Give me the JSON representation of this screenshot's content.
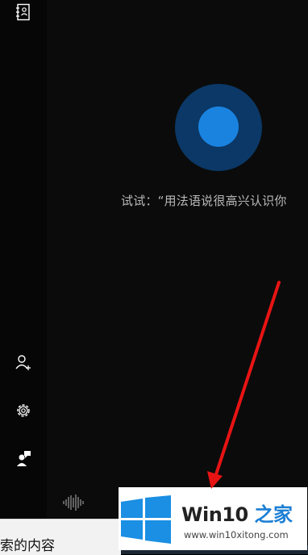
{
  "sidebar": {
    "items": [
      {
        "name": "notebook-icon"
      },
      {
        "name": "add-user-icon"
      },
      {
        "name": "gear-icon"
      },
      {
        "name": "feedback-icon"
      }
    ]
  },
  "cortana": {
    "suggestion": "试试：“用法语说很高兴认识你"
  },
  "search": {
    "partial_text": "索的内容"
  },
  "watermark": {
    "title_a": "Win10",
    "title_b": " 之家",
    "url": "www.win10xitong.com"
  },
  "colors": {
    "orb_outer": "#0b3866",
    "orb_inner": "#1a83e0",
    "arrow": "#e81414",
    "logo_blue": "#1b7fd4"
  }
}
